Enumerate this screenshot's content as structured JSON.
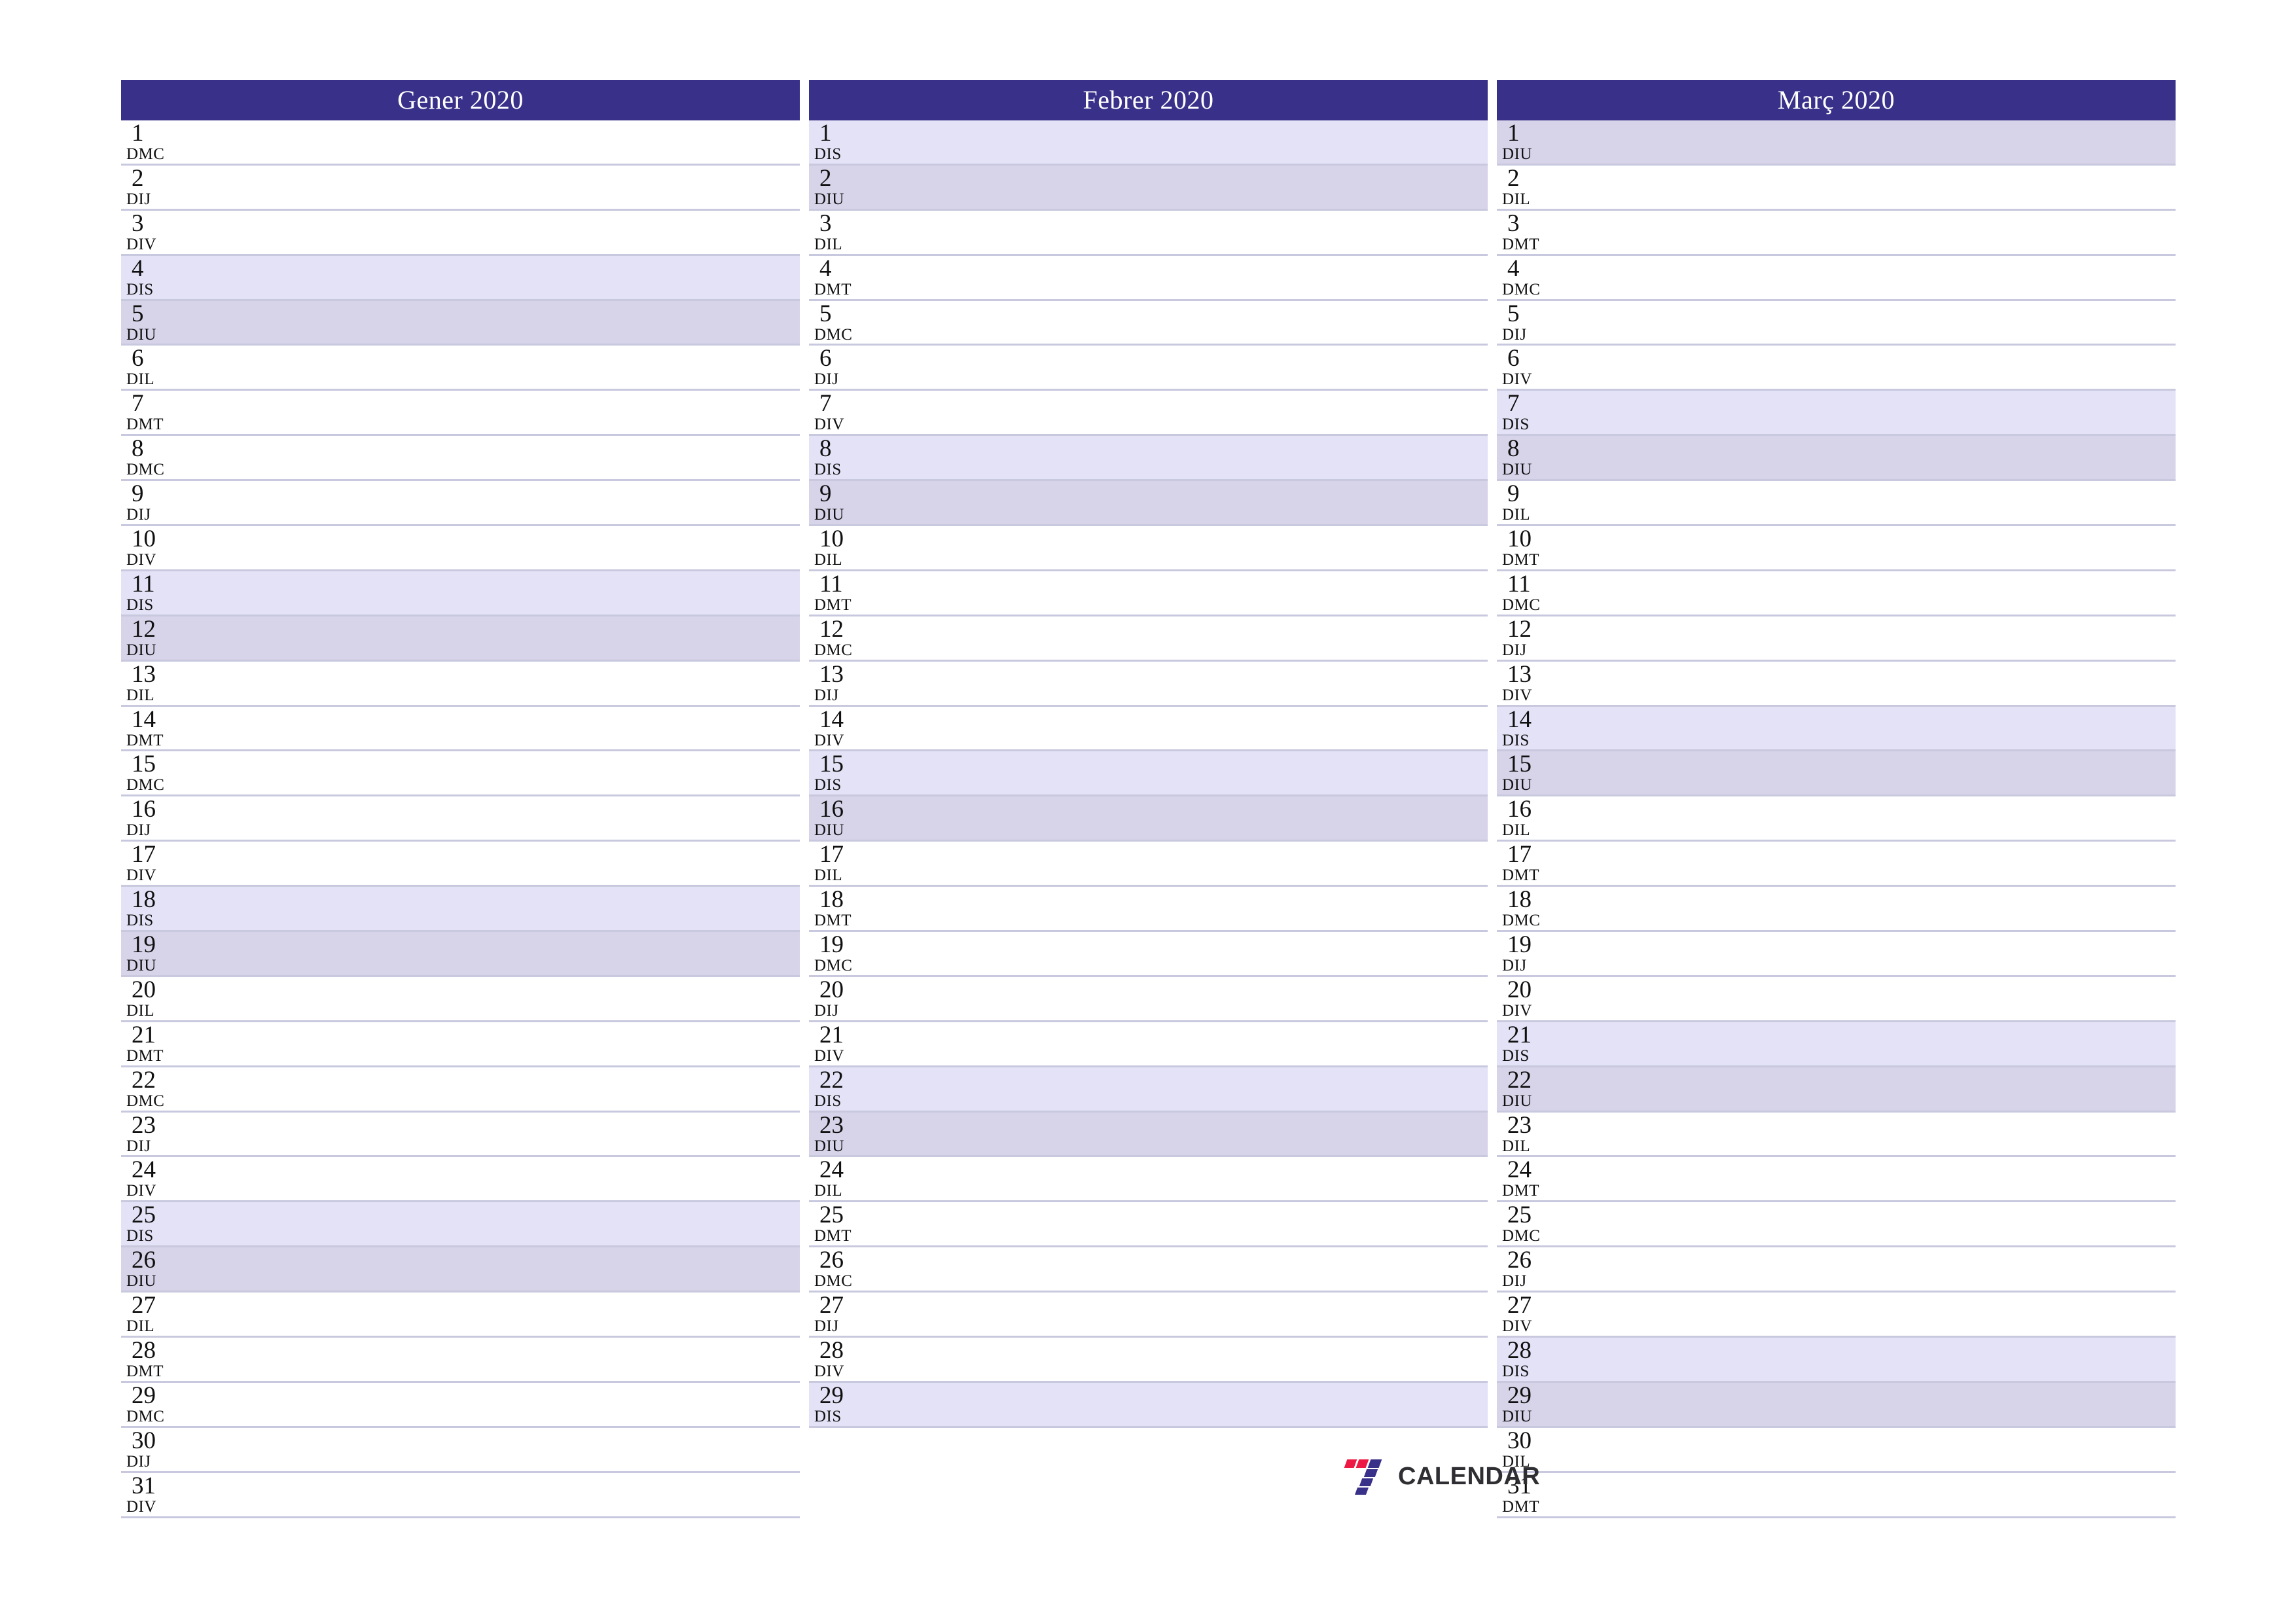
{
  "colors": {
    "header_bg": "#393189",
    "header_text": "#ffffff",
    "saturday_bg": "#e3e2f6",
    "sunday_bg": "#d7d3e9",
    "row_divider": "#c8c8de",
    "logo_red": "#ed1944",
    "logo_blue": "#393189",
    "logo_text": "#2f2f33"
  },
  "brand": {
    "name": "CALENDAR",
    "mark": "seven-logo"
  },
  "months": [
    {
      "title": "Gener 2020",
      "days": [
        {
          "num": "1",
          "weekday": "DMC",
          "type": "weekday"
        },
        {
          "num": "2",
          "weekday": "DIJ",
          "type": "weekday"
        },
        {
          "num": "3",
          "weekday": "DIV",
          "type": "weekday"
        },
        {
          "num": "4",
          "weekday": "DIS",
          "type": "saturday"
        },
        {
          "num": "5",
          "weekday": "DIU",
          "type": "sunday"
        },
        {
          "num": "6",
          "weekday": "DIL",
          "type": "weekday"
        },
        {
          "num": "7",
          "weekday": "DMT",
          "type": "weekday"
        },
        {
          "num": "8",
          "weekday": "DMC",
          "type": "weekday"
        },
        {
          "num": "9",
          "weekday": "DIJ",
          "type": "weekday"
        },
        {
          "num": "10",
          "weekday": "DIV",
          "type": "weekday"
        },
        {
          "num": "11",
          "weekday": "DIS",
          "type": "saturday"
        },
        {
          "num": "12",
          "weekday": "DIU",
          "type": "sunday"
        },
        {
          "num": "13",
          "weekday": "DIL",
          "type": "weekday"
        },
        {
          "num": "14",
          "weekday": "DMT",
          "type": "weekday"
        },
        {
          "num": "15",
          "weekday": "DMC",
          "type": "weekday"
        },
        {
          "num": "16",
          "weekday": "DIJ",
          "type": "weekday"
        },
        {
          "num": "17",
          "weekday": "DIV",
          "type": "weekday"
        },
        {
          "num": "18",
          "weekday": "DIS",
          "type": "saturday"
        },
        {
          "num": "19",
          "weekday": "DIU",
          "type": "sunday"
        },
        {
          "num": "20",
          "weekday": "DIL",
          "type": "weekday"
        },
        {
          "num": "21",
          "weekday": "DMT",
          "type": "weekday"
        },
        {
          "num": "22",
          "weekday": "DMC",
          "type": "weekday"
        },
        {
          "num": "23",
          "weekday": "DIJ",
          "type": "weekday"
        },
        {
          "num": "24",
          "weekday": "DIV",
          "type": "weekday"
        },
        {
          "num": "25",
          "weekday": "DIS",
          "type": "saturday"
        },
        {
          "num": "26",
          "weekday": "DIU",
          "type": "sunday"
        },
        {
          "num": "27",
          "weekday": "DIL",
          "type": "weekday"
        },
        {
          "num": "28",
          "weekday": "DMT",
          "type": "weekday"
        },
        {
          "num": "29",
          "weekday": "DMC",
          "type": "weekday"
        },
        {
          "num": "30",
          "weekday": "DIJ",
          "type": "weekday"
        },
        {
          "num": "31",
          "weekday": "DIV",
          "type": "weekday"
        }
      ]
    },
    {
      "title": "Febrer 2020",
      "days": [
        {
          "num": "1",
          "weekday": "DIS",
          "type": "saturday"
        },
        {
          "num": "2",
          "weekday": "DIU",
          "type": "sunday"
        },
        {
          "num": "3",
          "weekday": "DIL",
          "type": "weekday"
        },
        {
          "num": "4",
          "weekday": "DMT",
          "type": "weekday"
        },
        {
          "num": "5",
          "weekday": "DMC",
          "type": "weekday"
        },
        {
          "num": "6",
          "weekday": "DIJ",
          "type": "weekday"
        },
        {
          "num": "7",
          "weekday": "DIV",
          "type": "weekday"
        },
        {
          "num": "8",
          "weekday": "DIS",
          "type": "saturday"
        },
        {
          "num": "9",
          "weekday": "DIU",
          "type": "sunday"
        },
        {
          "num": "10",
          "weekday": "DIL",
          "type": "weekday"
        },
        {
          "num": "11",
          "weekday": "DMT",
          "type": "weekday"
        },
        {
          "num": "12",
          "weekday": "DMC",
          "type": "weekday"
        },
        {
          "num": "13",
          "weekday": "DIJ",
          "type": "weekday"
        },
        {
          "num": "14",
          "weekday": "DIV",
          "type": "weekday"
        },
        {
          "num": "15",
          "weekday": "DIS",
          "type": "saturday"
        },
        {
          "num": "16",
          "weekday": "DIU",
          "type": "sunday"
        },
        {
          "num": "17",
          "weekday": "DIL",
          "type": "weekday"
        },
        {
          "num": "18",
          "weekday": "DMT",
          "type": "weekday"
        },
        {
          "num": "19",
          "weekday": "DMC",
          "type": "weekday"
        },
        {
          "num": "20",
          "weekday": "DIJ",
          "type": "weekday"
        },
        {
          "num": "21",
          "weekday": "DIV",
          "type": "weekday"
        },
        {
          "num": "22",
          "weekday": "DIS",
          "type": "saturday"
        },
        {
          "num": "23",
          "weekday": "DIU",
          "type": "sunday"
        },
        {
          "num": "24",
          "weekday": "DIL",
          "type": "weekday"
        },
        {
          "num": "25",
          "weekday": "DMT",
          "type": "weekday"
        },
        {
          "num": "26",
          "weekday": "DMC",
          "type": "weekday"
        },
        {
          "num": "27",
          "weekday": "DIJ",
          "type": "weekday"
        },
        {
          "num": "28",
          "weekday": "DIV",
          "type": "weekday"
        },
        {
          "num": "29",
          "weekday": "DIS",
          "type": "saturday"
        }
      ]
    },
    {
      "title": "Març 2020",
      "days": [
        {
          "num": "1",
          "weekday": "DIU",
          "type": "sunday"
        },
        {
          "num": "2",
          "weekday": "DIL",
          "type": "weekday"
        },
        {
          "num": "3",
          "weekday": "DMT",
          "type": "weekday"
        },
        {
          "num": "4",
          "weekday": "DMC",
          "type": "weekday"
        },
        {
          "num": "5",
          "weekday": "DIJ",
          "type": "weekday"
        },
        {
          "num": "6",
          "weekday": "DIV",
          "type": "weekday"
        },
        {
          "num": "7",
          "weekday": "DIS",
          "type": "saturday"
        },
        {
          "num": "8",
          "weekday": "DIU",
          "type": "sunday"
        },
        {
          "num": "9",
          "weekday": "DIL",
          "type": "weekday"
        },
        {
          "num": "10",
          "weekday": "DMT",
          "type": "weekday"
        },
        {
          "num": "11",
          "weekday": "DMC",
          "type": "weekday"
        },
        {
          "num": "12",
          "weekday": "DIJ",
          "type": "weekday"
        },
        {
          "num": "13",
          "weekday": "DIV",
          "type": "weekday"
        },
        {
          "num": "14",
          "weekday": "DIS",
          "type": "saturday"
        },
        {
          "num": "15",
          "weekday": "DIU",
          "type": "sunday"
        },
        {
          "num": "16",
          "weekday": "DIL",
          "type": "weekday"
        },
        {
          "num": "17",
          "weekday": "DMT",
          "type": "weekday"
        },
        {
          "num": "18",
          "weekday": "DMC",
          "type": "weekday"
        },
        {
          "num": "19",
          "weekday": "DIJ",
          "type": "weekday"
        },
        {
          "num": "20",
          "weekday": "DIV",
          "type": "weekday"
        },
        {
          "num": "21",
          "weekday": "DIS",
          "type": "saturday"
        },
        {
          "num": "22",
          "weekday": "DIU",
          "type": "sunday"
        },
        {
          "num": "23",
          "weekday": "DIL",
          "type": "weekday"
        },
        {
          "num": "24",
          "weekday": "DMT",
          "type": "weekday"
        },
        {
          "num": "25",
          "weekday": "DMC",
          "type": "weekday"
        },
        {
          "num": "26",
          "weekday": "DIJ",
          "type": "weekday"
        },
        {
          "num": "27",
          "weekday": "DIV",
          "type": "weekday"
        },
        {
          "num": "28",
          "weekday": "DIS",
          "type": "saturday"
        },
        {
          "num": "29",
          "weekday": "DIU",
          "type": "sunday"
        },
        {
          "num": "30",
          "weekday": "DIL",
          "type": "weekday"
        },
        {
          "num": "31",
          "weekday": "DMT",
          "type": "weekday"
        }
      ]
    }
  ]
}
